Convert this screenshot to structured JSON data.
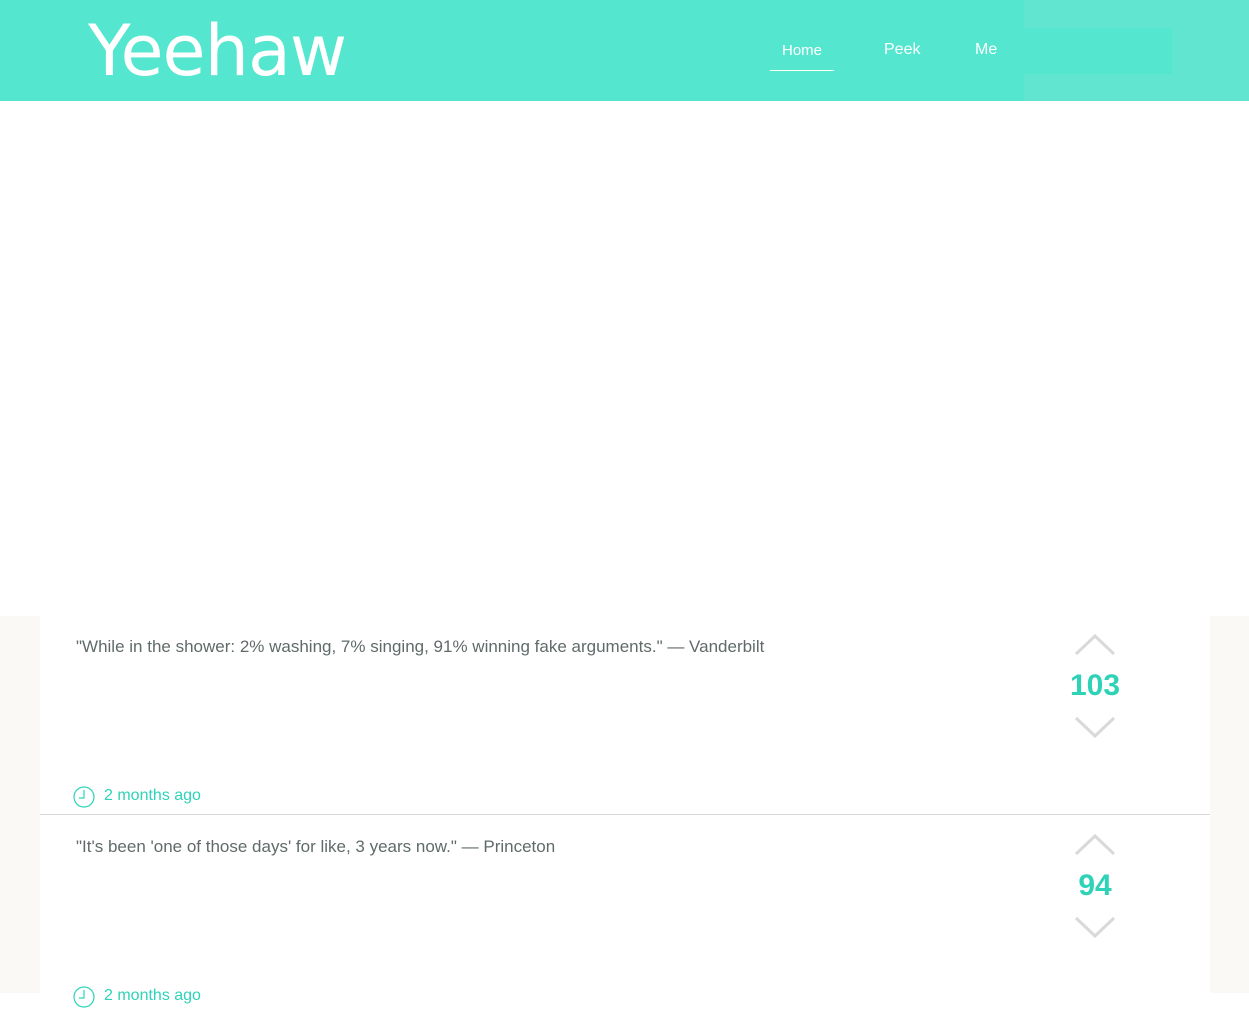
{
  "header": {
    "logo": "Yeehaw",
    "nav": {
      "home": "Home",
      "peek": "Peek",
      "me": "Me"
    },
    "colors": {
      "bar": "#55e6cf",
      "accent": "#2ed3b7"
    }
  },
  "posts": [
    {
      "text": "\"While in the shower: 2% washing, 7% singing, 91% winning fake arguments.\" — Vanderbilt",
      "votes": "103",
      "time": "2 months ago"
    },
    {
      "text": "\"It's been 'one of those days' for like, 3 years now.\" — Princeton",
      "votes": "94",
      "time": "2 months ago"
    }
  ]
}
